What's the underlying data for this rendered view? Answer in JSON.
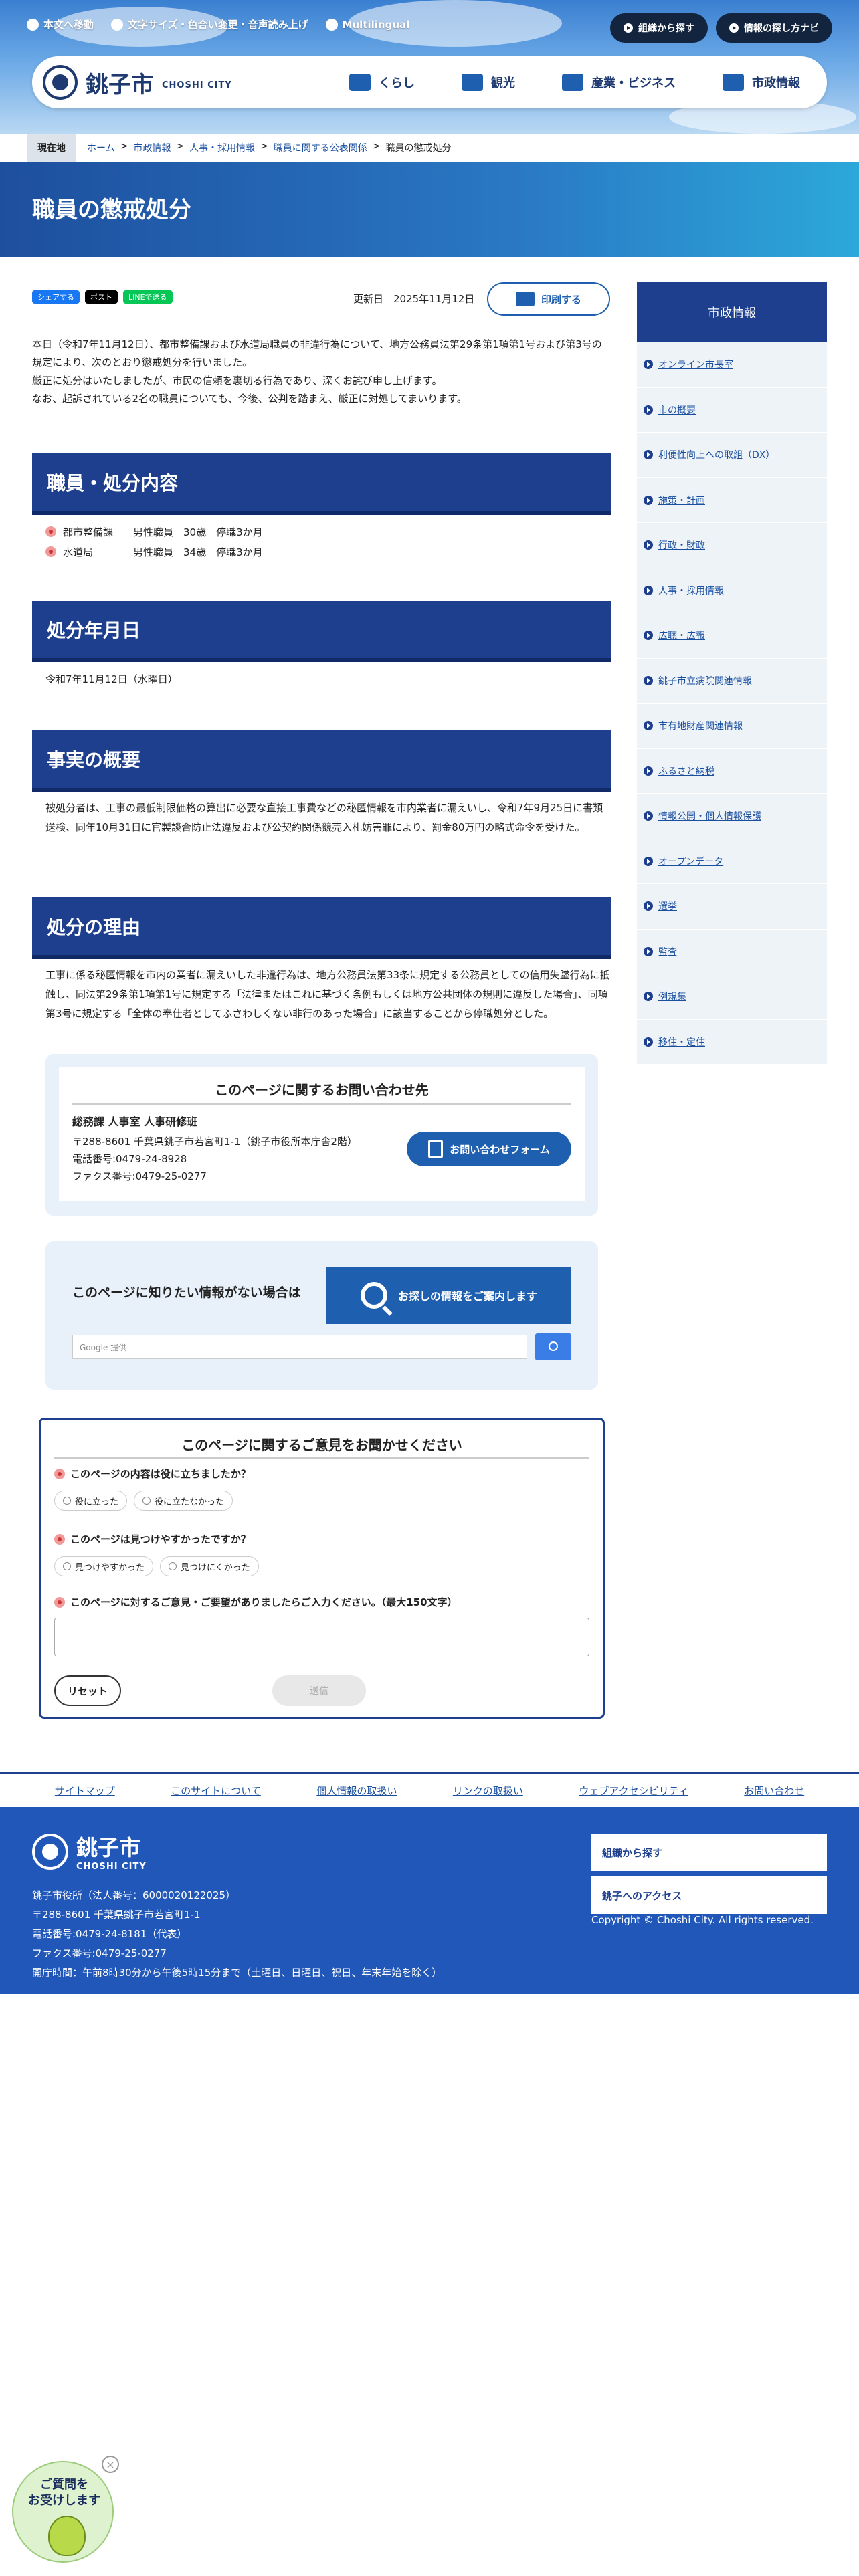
{
  "header": {
    "util": [
      "本文へ移動",
      "文字サイズ・色合い変更・音声読み上げ",
      "Multilingual"
    ],
    "buttons": [
      "組織から探す",
      "情報の探し方ナビ"
    ],
    "logo_jp": "銚子市",
    "logo_en": "CHOSHI CITY",
    "nav": [
      "くらし",
      "観光",
      "産業・ビジネス",
      "市政情報"
    ]
  },
  "breadcrumb": {
    "here": "現在地",
    "items": [
      "ホーム",
      "市政情報",
      "人事・採用情報",
      "職員に関する公表関係",
      "職員の懲戒処分"
    ]
  },
  "page_title": "職員の懲戒処分",
  "share": {
    "facebook": "シェアする",
    "x": "ポスト",
    "line": "LINEで送る"
  },
  "updated": "更新日　2025年11月12日",
  "print_label": "印刷する",
  "intro": [
    "本日（令和7年11月12日）、都市整備課および水道局職員の非違行為について、地方公務員法第29条第1項第1号および第3号の規定により、次のとおり懲戒処分を行いました。",
    "厳正に処分はいたしましたが、市民の信頼を裏切る行為であり、深くお詫び申し上げます。",
    "なお、起訴されている2名の職員についても、今後、公判を踏まえ、厳正に対処してまいります。"
  ],
  "sections": {
    "s1": {
      "title": "職員・処分内容",
      "items": [
        "都市整備課　　男性職員　30歳　停職3か月",
        "水道局　　　　男性職員　34歳　停職3か月"
      ]
    },
    "s2": {
      "title": "処分年月日",
      "text": "令和7年11月12日（水曜日）"
    },
    "s3": {
      "title": "事実の概要",
      "text": "被処分者は、工事の最低制限価格の算出に必要な直接工事費などの秘匿情報を市内業者に漏えいし、令和7年9月25日に書類送検、同年10月31日に官製談合防止法違反および公契約関係競売入札妨害罪により、罰金80万円の略式命令を受けた。"
    },
    "s4": {
      "title": "処分の理由",
      "text": "工事に係る秘匿情報を市内の業者に漏えいした非違行為は、地方公務員法第33条に規定する公務員としての信用失墜行為に抵触し、同法第29条第1項第1号に規定する「法律またはこれに基づく条例もしくは地方公共団体の規則に違反した場合」、同項第3号に規定する「全体の奉仕者としてふさわしくない非行のあった場合」に該当することから停職処分とした。"
    }
  },
  "contact": {
    "title": "このページに関するお問い合わせ先",
    "dept": "総務課 人事室 人事研修班",
    "address": "〒288-8601 千葉県銚子市若宮町1-1（銚子市役所本庁舎2階）",
    "tel": "電話番号:0479-24-8928",
    "fax": "ファクス番号:0479-25-0277",
    "button": "お問い合わせフォーム"
  },
  "search": {
    "label": "このページに知りたい情報がない場合は",
    "big_button": "お探しの情報をご案内します",
    "placeholder": "Google 提供"
  },
  "feedback": {
    "title": "このページに関するご意見をお聞かせください",
    "q1": "このページの内容は役に立ちましたか？",
    "q1_opts": [
      "役に立った",
      "役に立たなかった"
    ],
    "q2": "このページは見つけやすかったですか？",
    "q2_opts": [
      "見つけやすかった",
      "見つけにくかった"
    ],
    "q3": "このページに対するご意見・ご要望がありましたらご入力ください。（最大150文字）",
    "reset": "リセット",
    "send": "送信"
  },
  "sidebar": {
    "title": "市政情報",
    "items": [
      "オンライン市長室",
      "市の概要",
      "利便性向上への取組（DX）",
      "施策・計画",
      "行政・財政",
      "人事・採用情報",
      "広聴・広報",
      "銚子市立病院関連情報",
      "市有地財産関連情報",
      "ふるさと納税",
      "情報公開・個人情報保護",
      "オープンデータ",
      "選挙",
      "監査",
      "例規集",
      "移住・定住"
    ]
  },
  "footer": {
    "links": [
      "サイトマップ",
      "このサイトについて",
      "個人情報の取扱い",
      "リンクの取扱い",
      "ウェブアクセシビリティ",
      "お問い合わせ"
    ],
    "logo_jp": "銚子市",
    "logo_en": "CHOSHI CITY",
    "lines": [
      "銚子市役所（法人番号：6000020122025）",
      "〒288-8601 千葉県銚子市若宮町1-1",
      "電話番号:0479-24-8181（代表）",
      "ファクス番号:0479-25-0277",
      "開庁時間：午前8時30分から午後5時15分まで（土曜日、日曜日、祝日、年末年始を除く）"
    ],
    "btn1": "組織から探す",
    "btn2": "銚子へのアクセス",
    "copyright": "Copyright © Choshi City. All rights reserved."
  },
  "bot": {
    "line1": "ご質問を",
    "line2": "お受けします"
  },
  "colors": {
    "brand": "#1d3f8e",
    "accent": "#1e5fb0",
    "sub_bg": "#e8f0f9"
  }
}
